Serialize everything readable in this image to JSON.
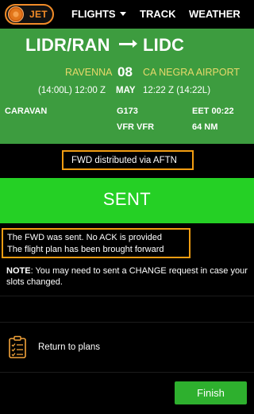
{
  "nav": {
    "logo_text": "JET",
    "flights": "FLIGHTS",
    "track": "TRACK",
    "weather": "WEATHER"
  },
  "flight": {
    "departure_code": "LIDR/RAN",
    "arrival_code": "LIDC",
    "departure_name": "RAVENNA",
    "arrival_name": "CA NEGRA AIRPORT",
    "day": "08",
    "month": "MAY",
    "departure_time": "(14:00L) 12:00 Z",
    "arrival_time": "12:22 Z (14:22L)",
    "aircraft": "CARAVAN",
    "callsign": "G173",
    "eet": "EET 00:22",
    "rules": "VFR VFR",
    "distance": "64 NM"
  },
  "distribution": "FWD distributed via AFTN",
  "status": "SENT",
  "messages": {
    "line1": "The FWD was sent. No ACK is provided",
    "line2": "The flight plan has been brought forward"
  },
  "note": {
    "label": "NOTE",
    "text": ": You may need to sent a CHANGE request in case your slots changed."
  },
  "return_label": "Return to plans",
  "finish_label": "Finish",
  "colors": {
    "flight_panel": "#3d9c3f",
    "status_bar": "#25d025",
    "highlight_border": "#f29d12",
    "logo_accent": "#f28c28",
    "airport_text": "#e8d96b",
    "finish_button": "#2eb02e"
  }
}
